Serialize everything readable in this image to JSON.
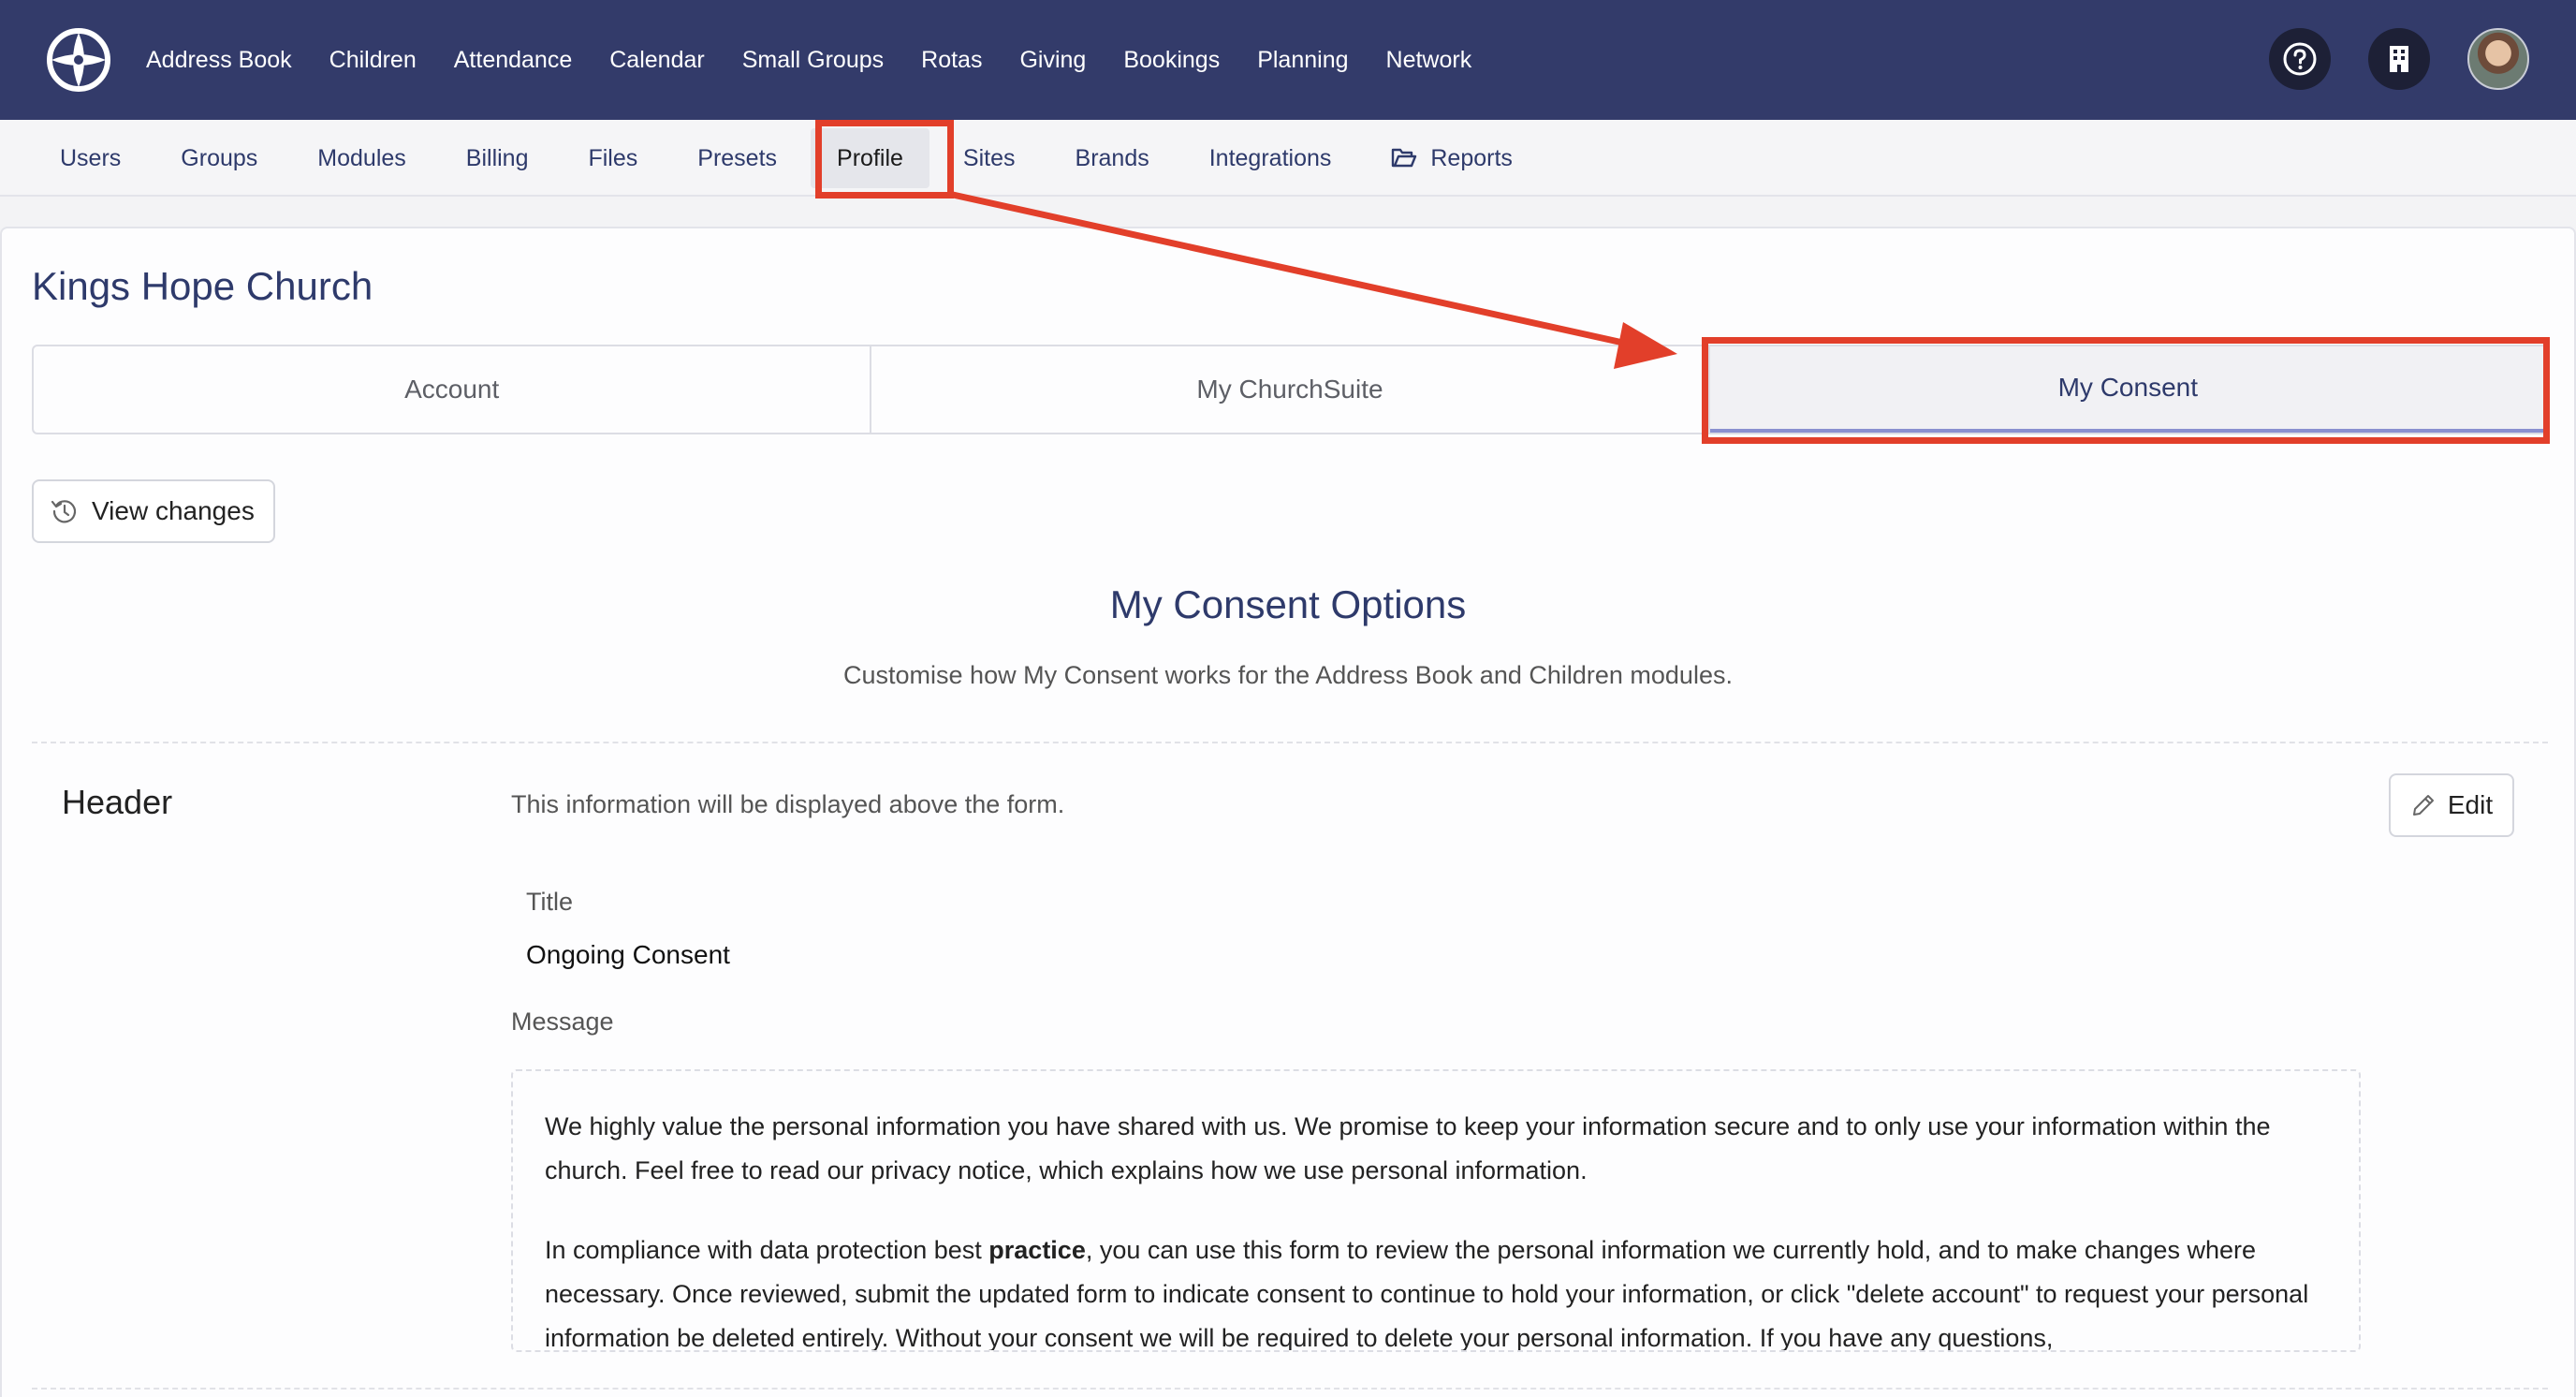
{
  "topnav": {
    "items": [
      "Address Book",
      "Children",
      "Attendance",
      "Calendar",
      "Small Groups",
      "Rotas",
      "Giving",
      "Bookings",
      "Planning",
      "Network"
    ]
  },
  "subnav": {
    "items": [
      {
        "label": "Users",
        "active": false
      },
      {
        "label": "Groups",
        "active": false
      },
      {
        "label": "Modules",
        "active": false
      },
      {
        "label": "Billing",
        "active": false
      },
      {
        "label": "Files",
        "active": false
      },
      {
        "label": "Presets",
        "active": false
      },
      {
        "label": "Profile",
        "active": true
      },
      {
        "label": "Sites",
        "active": false
      },
      {
        "label": "Brands",
        "active": false
      },
      {
        "label": "Integrations",
        "active": false
      },
      {
        "label": "Reports",
        "active": false
      }
    ]
  },
  "page": {
    "org_name": "Kings Hope Church",
    "tabs": [
      "Account",
      "My ChurchSuite",
      "My Consent"
    ],
    "view_changes": "View changes",
    "section_title": "My Consent Options",
    "section_subtitle": "Customise how My Consent works for the Address Book and Children modules."
  },
  "header_section": {
    "label": "Header",
    "description": "This information will be displayed above the form.",
    "edit": "Edit",
    "title_label": "Title",
    "title_value": "Ongoing Consent",
    "message_label": "Message",
    "message_p1": "We highly value the personal information you have shared with us. We promise to keep your information secure and to only use your information within the church. Feel free to read our privacy notice, which explains how we use personal information.",
    "message_p2_before": "In compliance with data protection best ",
    "message_p2_bold": "practice",
    "message_p2_after": ", you can use this form to review the personal information we currently hold, and to make changes where necessary. Once reviewed, submit the updated form to indicate consent to continue to hold your information, or click \"delete account\" to request your personal information be deleted entirely. Without your consent we will be required to delete your personal information. If you have any questions,"
  },
  "colors": {
    "topbar": "#333b6a",
    "accent": "#2e3a6b",
    "annotation": "#e23f2a"
  },
  "icons": [
    "logo-icon",
    "help-icon",
    "building-icon",
    "folder-icon",
    "history-icon",
    "pencil-icon"
  ]
}
